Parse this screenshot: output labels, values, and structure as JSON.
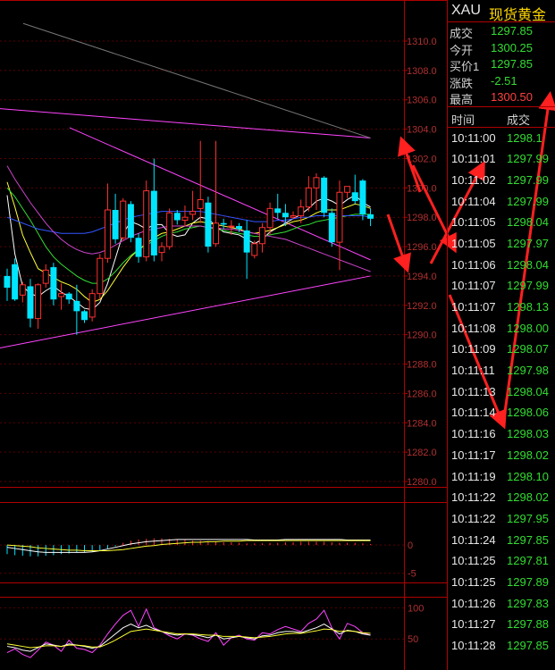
{
  "header": {
    "symbol": "XAU",
    "instrument": "现货黄金"
  },
  "quotes": [
    {
      "label": "成交",
      "value": "1297.85",
      "color": "green"
    },
    {
      "label": "今开",
      "value": "1300.25",
      "color": "green"
    },
    {
      "label": "买价1",
      "value": "1297.85",
      "color": "green"
    },
    {
      "label": "涨跌",
      "value": "-2.51",
      "color": "green"
    },
    {
      "label": "最高",
      "value": "1300.50",
      "color": "red"
    }
  ],
  "ticks_header": {
    "time": "时间",
    "price": "成交"
  },
  "ticks": [
    {
      "time": "10:11:00",
      "price": "1298.1"
    },
    {
      "time": "10:11:01",
      "price": "1297.99"
    },
    {
      "time": "10:11:02",
      "price": "1297.99"
    },
    {
      "time": "10:11:04",
      "price": "1297.99"
    },
    {
      "time": "10:11:05",
      "price": "1298.04"
    },
    {
      "time": "10:11:05",
      "price": "1297.97"
    },
    {
      "time": "10:11:06",
      "price": "1298.04"
    },
    {
      "time": "10:11:07",
      "price": "1297.99"
    },
    {
      "time": "10:11:07",
      "price": "1298.13"
    },
    {
      "time": "10:11:08",
      "price": "1298.00"
    },
    {
      "time": "10:11:09",
      "price": "1298.07"
    },
    {
      "time": "10:11:11",
      "price": "1297.98"
    },
    {
      "time": "10:11:13",
      "price": "1298.04"
    },
    {
      "time": "10:11:14",
      "price": "1298.06"
    },
    {
      "time": "10:11:16",
      "price": "1298.03"
    },
    {
      "time": "10:11:17",
      "price": "1298.02"
    },
    {
      "time": "10:11:19",
      "price": "1298.10"
    },
    {
      "time": "10:11:22",
      "price": "1298.02"
    },
    {
      "time": "10:11:22",
      "price": "1297.95"
    },
    {
      "time": "10:11:24",
      "price": "1297.85"
    },
    {
      "time": "10:11:25",
      "price": "1297.81"
    },
    {
      "time": "10:11:25",
      "price": "1297.89"
    },
    {
      "time": "10:11:26",
      "price": "1297.83"
    },
    {
      "time": "10:11:27",
      "price": "1297.88"
    },
    {
      "time": "10:11:28",
      "price": "1297.85"
    }
  ],
  "colors": {
    "up": "#ff3030",
    "down": "#00e5ff",
    "panel_border": "#b00000",
    "price_green": "#33dd33",
    "annotation": "#ff2020"
  },
  "chart_data": [
    {
      "type": "candlestick",
      "ylim": [
        1280,
        1311
      ],
      "yticks": [
        "1310.0",
        "1308.0",
        "1306.0",
        "1304.0",
        "1302.0",
        "1300.0",
        "1298.0",
        "1296.0",
        "1294.0",
        "1292.0",
        "1290.0",
        "1288.0",
        "1286.0",
        "1284.0",
        "1282.0",
        "1280.0"
      ],
      "candles": [
        {
          "o": 1294.0,
          "h": 1294.5,
          "l": 1292.3,
          "c": 1293.2
        },
        {
          "o": 1294.8,
          "h": 1295.2,
          "l": 1292.3,
          "c": 1292.4
        },
        {
          "o": 1292.7,
          "h": 1293.6,
          "l": 1292.2,
          "c": 1293.4
        },
        {
          "o": 1293.3,
          "h": 1293.8,
          "l": 1290.5,
          "c": 1291.1
        },
        {
          "o": 1291.1,
          "h": 1293.5,
          "l": 1290.4,
          "c": 1293.4
        },
        {
          "o": 1293.5,
          "h": 1294.8,
          "l": 1293.2,
          "c": 1294.4
        },
        {
          "o": 1294.6,
          "h": 1294.9,
          "l": 1292.0,
          "c": 1292.4
        },
        {
          "o": 1292.6,
          "h": 1293.5,
          "l": 1291.7,
          "c": 1292.8
        },
        {
          "o": 1292.8,
          "h": 1292.9,
          "l": 1292.1,
          "c": 1292.4
        },
        {
          "o": 1292.3,
          "h": 1293.4,
          "l": 1290.0,
          "c": 1291.6
        },
        {
          "o": 1291.6,
          "h": 1291.7,
          "l": 1290.8,
          "c": 1291.0
        },
        {
          "o": 1291.2,
          "h": 1293.1,
          "l": 1290.9,
          "c": 1292.8
        },
        {
          "o": 1292.8,
          "h": 1295.5,
          "l": 1292.4,
          "c": 1295.2
        },
        {
          "o": 1295.2,
          "h": 1300.3,
          "l": 1294.9,
          "c": 1298.5
        },
        {
          "o": 1298.5,
          "h": 1299.6,
          "l": 1296.2,
          "c": 1296.5
        },
        {
          "o": 1296.6,
          "h": 1299.3,
          "l": 1296.4,
          "c": 1299.1
        },
        {
          "o": 1298.9,
          "h": 1299.1,
          "l": 1296.3,
          "c": 1296.6
        },
        {
          "o": 1296.6,
          "h": 1296.9,
          "l": 1294.9,
          "c": 1295.3
        },
        {
          "o": 1295.3,
          "h": 1300.5,
          "l": 1295.0,
          "c": 1299.8
        },
        {
          "o": 1299.8,
          "h": 1302.0,
          "l": 1295.0,
          "c": 1295.4
        },
        {
          "o": 1295.6,
          "h": 1296.3,
          "l": 1295.0,
          "c": 1296.0
        },
        {
          "o": 1296.0,
          "h": 1298.6,
          "l": 1295.8,
          "c": 1298.3
        },
        {
          "o": 1298.3,
          "h": 1298.5,
          "l": 1297.5,
          "c": 1297.8
        },
        {
          "o": 1297.8,
          "h": 1298.8,
          "l": 1297.4,
          "c": 1298.0
        },
        {
          "o": 1298.2,
          "h": 1299.8,
          "l": 1297.8,
          "c": 1298.4
        },
        {
          "o": 1298.6,
          "h": 1303.2,
          "l": 1297.6,
          "c": 1299.2
        },
        {
          "o": 1299.0,
          "h": 1299.4,
          "l": 1295.6,
          "c": 1296.0
        },
        {
          "o": 1296.2,
          "h": 1303.2,
          "l": 1296.0,
          "c": 1297.6
        },
        {
          "o": 1297.6,
          "h": 1297.9,
          "l": 1297.2,
          "c": 1297.5
        },
        {
          "o": 1297.4,
          "h": 1297.8,
          "l": 1296.8,
          "c": 1297.4
        },
        {
          "o": 1297.4,
          "h": 1297.6,
          "l": 1297.0,
          "c": 1297.2
        },
        {
          "o": 1297.1,
          "h": 1297.8,
          "l": 1293.8,
          "c": 1295.6
        },
        {
          "o": 1295.4,
          "h": 1296.4,
          "l": 1295.2,
          "c": 1296.2
        },
        {
          "o": 1296.2,
          "h": 1297.6,
          "l": 1295.6,
          "c": 1297.3
        },
        {
          "o": 1297.3,
          "h": 1299.0,
          "l": 1296.8,
          "c": 1298.6
        },
        {
          "o": 1298.6,
          "h": 1299.6,
          "l": 1297.9,
          "c": 1298.3
        },
        {
          "o": 1298.3,
          "h": 1298.9,
          "l": 1297.4,
          "c": 1298.0
        },
        {
          "o": 1298.0,
          "h": 1298.4,
          "l": 1297.9,
          "c": 1298.1
        },
        {
          "o": 1298.1,
          "h": 1299.2,
          "l": 1297.6,
          "c": 1298.7
        },
        {
          "o": 1298.7,
          "h": 1300.8,
          "l": 1298.4,
          "c": 1300.0
        },
        {
          "o": 1300.0,
          "h": 1301.0,
          "l": 1298.5,
          "c": 1300.7
        },
        {
          "o": 1300.7,
          "h": 1300.8,
          "l": 1298.0,
          "c": 1298.3
        },
        {
          "o": 1298.3,
          "h": 1298.6,
          "l": 1296.0,
          "c": 1296.3
        },
        {
          "o": 1296.3,
          "h": 1300.5,
          "l": 1294.4,
          "c": 1299.7
        },
        {
          "o": 1299.7,
          "h": 1300.1,
          "l": 1299.3,
          "c": 1300.1
        },
        {
          "o": 1299.7,
          "h": 1300.9,
          "l": 1298.9,
          "c": 1299.1
        },
        {
          "o": 1300.5,
          "h": 1300.6,
          "l": 1297.8,
          "c": 1298.2
        },
        {
          "o": 1298.2,
          "h": 1298.6,
          "l": 1297.4,
          "c": 1297.9
        }
      ],
      "trendlines": [
        {
          "color": "#ff44ff",
          "from": [
            0,
            1305.4
          ],
          "to": [
            47,
            1303.4
          ]
        },
        {
          "color": "#ff44ff",
          "from": [
            0,
            1289.1
          ],
          "to": [
            47,
            1294.0
          ]
        },
        {
          "color": "#ff44ff",
          "from": [
            9,
            1304.1
          ],
          "to": [
            47,
            1295.1
          ]
        },
        {
          "color": "#777777",
          "from": [
            3,
            1311.2
          ],
          "to": [
            47,
            1303.4
          ]
        }
      ],
      "moving_averages": [
        {
          "color": "#ffffff",
          "values": [
            1299.5,
            1295.5,
            1293.3,
            1292.8,
            1292.6,
            1293.0,
            1293.3,
            1292.9,
            1292.6,
            1292.2,
            1291.8,
            1291.7,
            1292.2,
            1293.5,
            1295.2,
            1296.9,
            1297.7,
            1297.5,
            1297.2,
            1297.5,
            1297.5,
            1296.9,
            1296.7,
            1296.8,
            1297.6,
            1298.0,
            1297.9,
            1297.4,
            1297.0,
            1296.9,
            1296.8,
            1296.5,
            1296.2,
            1296.5,
            1297.0,
            1297.3,
            1297.6,
            1297.9,
            1298.2,
            1298.6,
            1299.1,
            1299.3,
            1299.1,
            1298.8,
            1299.2,
            1299.5,
            1299.0,
            1298.7
          ]
        },
        {
          "color": "#ffff33",
          "values": [
            1300.4,
            1298.7,
            1296.8,
            1295.6,
            1294.5,
            1294.2,
            1293.9,
            1293.6,
            1293.4,
            1293.1,
            1292.6,
            1292.2,
            1292.4,
            1293.0,
            1293.8,
            1294.6,
            1295.3,
            1295.8,
            1296.2,
            1296.6,
            1296.9,
            1297.0,
            1297.2,
            1297.4,
            1297.6,
            1297.7,
            1297.6,
            1297.5,
            1297.4,
            1297.3,
            1297.2,
            1297.0,
            1296.9,
            1297.0,
            1297.1,
            1297.3,
            1297.5,
            1297.7,
            1297.8,
            1298.0,
            1298.3,
            1298.5,
            1298.5,
            1298.5,
            1298.7,
            1298.9,
            1298.8,
            1298.6
          ]
        },
        {
          "color": "#33dd33",
          "values": [
            1300.0,
            1299.4,
            1298.6,
            1297.8,
            1296.9,
            1296.0,
            1295.3,
            1294.8,
            1294.4,
            1294.0,
            1293.7,
            1293.5,
            1293.5,
            1293.8,
            1294.3,
            1294.9,
            1295.4,
            1295.8,
            1296.1,
            1296.4,
            1296.7,
            1296.9,
            1297.0,
            1297.2,
            1297.3,
            1297.4,
            1297.3,
            1297.2,
            1297.1,
            1297.0,
            1296.9,
            1296.8,
            1296.7,
            1296.7,
            1296.8,
            1296.9,
            1297.0,
            1297.2,
            1297.4,
            1297.5,
            1297.7,
            1297.8,
            1297.9,
            1298.0,
            1298.1,
            1298.2,
            1298.2,
            1298.2
          ]
        },
        {
          "color": "#3355ff",
          "values": [
            1298.0,
            1297.8,
            1297.6,
            1297.4,
            1297.2,
            1297.1,
            1297.0,
            1296.9,
            1296.9,
            1296.9,
            1296.9,
            1297.0,
            1297.2,
            1297.4,
            1297.6,
            1297.8,
            1298.0,
            1298.1,
            1298.2,
            1298.3,
            1298.4,
            1298.4,
            1298.4,
            1298.4,
            1298.4,
            1298.4,
            1298.3,
            1298.2,
            1298.1,
            1298.0,
            1297.9,
            1297.8,
            1297.7,
            1297.7,
            1297.7,
            1297.8,
            1297.8,
            1297.9,
            1298.0,
            1298.0,
            1298.1,
            1298.1,
            1298.1,
            1298.1,
            1298.1,
            1298.1,
            1298.1,
            1298.0
          ]
        },
        {
          "color": "#cc44cc",
          "values": [
            1301.5,
            1300.6,
            1299.8,
            1299.0,
            1298.3,
            1297.6,
            1297.0,
            1296.5,
            1296.1,
            1295.8,
            1295.6,
            1295.5,
            1295.6,
            1295.8,
            1296.1,
            1296.4,
            1296.7,
            1296.9,
            1297.1,
            1297.2,
            1297.3,
            1297.4,
            1297.4,
            1297.4,
            1297.4,
            1297.4,
            1297.3,
            1297.3,
            1297.2,
            1297.2,
            1297.1,
            1297.0,
            1296.9,
            1296.8,
            1296.7,
            1296.6,
            1296.5,
            1296.3,
            1296.1,
            1295.9,
            1295.7,
            1295.5,
            1295.3,
            1295.1,
            1294.9,
            1294.7,
            1294.5,
            1294.3
          ]
        }
      ]
    },
    {
      "type": "macd",
      "ylim": [
        -6,
        7
      ],
      "yticks": [
        "0",
        "-5"
      ],
      "histogram": [
        -1.6,
        -1.8,
        -1.9,
        -2.0,
        -2.0,
        -1.9,
        -1.8,
        -1.6,
        -1.5,
        -1.4,
        -1.3,
        -1.2,
        -1.0,
        -0.6,
        -0.2,
        0.4,
        0.8,
        1.0,
        1.1,
        1.2,
        1.2,
        1.1,
        1.0,
        0.9,
        0.8,
        0.8,
        0.7,
        0.6,
        0.5,
        0.5,
        0.4,
        0.3,
        0.3,
        0.3,
        0.4,
        0.4,
        0.5,
        0.5,
        0.6,
        0.6,
        0.6,
        0.6,
        0.5,
        0.4,
        0.4,
        0.4,
        0.3,
        0.2
      ],
      "dif": [
        -0.4,
        -0.6,
        -0.8,
        -1.0,
        -1.2,
        -1.3,
        -1.3,
        -1.3,
        -1.3,
        -1.3,
        -1.3,
        -1.2,
        -1.0,
        -0.7,
        -0.4,
        -0.1,
        0.2,
        0.4,
        0.6,
        0.7,
        0.8,
        0.9,
        1.0,
        1.0,
        1.0,
        1.0,
        1.0,
        1.0,
        1.0,
        1.0,
        1.0,
        1.0,
        0.9,
        0.9,
        0.9,
        0.9,
        1.0,
        1.0,
        1.0,
        1.0,
        1.0,
        1.0,
        1.0,
        1.0,
        0.9,
        0.9,
        0.9,
        0.9
      ],
      "dea": [
        0.0,
        -0.1,
        -0.2,
        -0.3,
        -0.5,
        -0.6,
        -0.7,
        -0.8,
        -0.9,
        -0.9,
        -1.0,
        -1.0,
        -1.0,
        -1.0,
        -0.9,
        -0.8,
        -0.6,
        -0.4,
        -0.2,
        -0.1,
        0.1,
        0.2,
        0.3,
        0.4,
        0.5,
        0.5,
        0.6,
        0.6,
        0.7,
        0.7,
        0.7,
        0.8,
        0.8,
        0.8,
        0.8,
        0.8,
        0.8,
        0.8,
        0.8,
        0.8,
        0.8,
        0.8,
        0.8,
        0.8,
        0.8,
        0.8,
        0.8,
        0.8
      ]
    },
    {
      "type": "oscillator",
      "ylim": [
        0,
        115
      ],
      "yticks": [
        "100",
        "50"
      ],
      "series": [
        {
          "color": "#ff44ff",
          "values": [
            28,
            34,
            25,
            20,
            32,
            45,
            40,
            30,
            48,
            35,
            33,
            28,
            40,
            58,
            74,
            88,
            96,
            70,
            98,
            68,
            62,
            55,
            50,
            58,
            56,
            50,
            46,
            60,
            40,
            52,
            56,
            50,
            48,
            60,
            58,
            65,
            70,
            66,
            62,
            75,
            82,
            96,
            68,
            50,
            75,
            70,
            60,
            56
          ]
        },
        {
          "color": "#ffffff",
          "values": [
            38,
            36,
            32,
            30,
            36,
            42,
            40,
            38,
            42,
            40,
            38,
            35,
            38,
            48,
            58,
            68,
            74,
            68,
            72,
            66,
            62,
            58,
            56,
            58,
            57,
            55,
            52,
            56,
            50,
            52,
            54,
            52,
            50,
            55,
            56,
            60,
            62,
            62,
            60,
            64,
            68,
            74,
            66,
            58,
            64,
            62,
            58,
            56
          ]
        },
        {
          "color": "#ffff33",
          "values": [
            42,
            40,
            38,
            36,
            37,
            39,
            39,
            38,
            40,
            40,
            39,
            37,
            37,
            42,
            48,
            55,
            62,
            64,
            66,
            64,
            62,
            60,
            58,
            58,
            58,
            57,
            56,
            56,
            54,
            54,
            54,
            53,
            52,
            53,
            54,
            56,
            58,
            59,
            59,
            61,
            63,
            66,
            65,
            62,
            63,
            62,
            60,
            59
          ]
        }
      ]
    }
  ]
}
